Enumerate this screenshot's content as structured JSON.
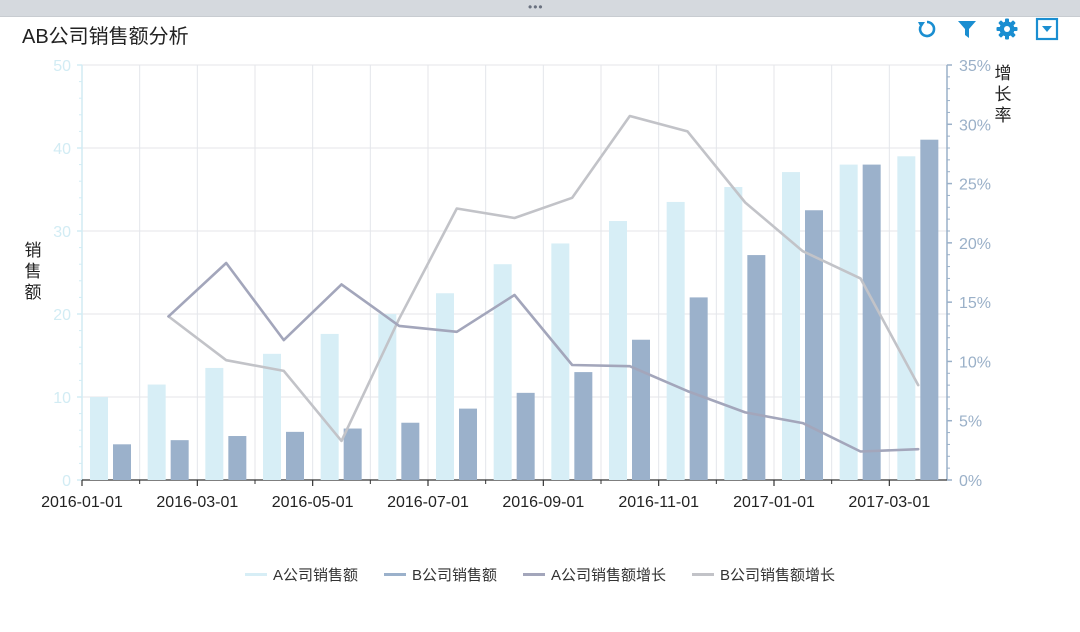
{
  "title": "AB公司销售额分析",
  "handle": "•••",
  "toolbar": [
    {
      "name": "refresh-icon",
      "icon": "refresh"
    },
    {
      "name": "filter-icon",
      "icon": "filter"
    },
    {
      "name": "gear-icon",
      "icon": "gear"
    },
    {
      "name": "dropdown-icon",
      "icon": "dropdown"
    }
  ],
  "colors": {
    "a_sales": "#d7eef6",
    "b_sales": "#9bb1cb",
    "a_growth": "#a3a6bb",
    "b_growth": "#c2c3c8",
    "toolbar": "#1a8ed1",
    "left_axis": "#d2ecf4",
    "right_axis": "#9ab0c8"
  },
  "chart_data": {
    "type": "bar",
    "title": "AB公司销售额分析",
    "x_ticks": [
      "2016-01-01",
      "2016-03-01",
      "2016-05-01",
      "2016-07-01",
      "2016-09-01",
      "2016-11-01",
      "2017-01-01",
      "2017-03-01"
    ],
    "y_left": {
      "label": "销售额",
      "min": 0,
      "max": 50,
      "ticks": [
        0,
        10,
        20,
        30,
        40,
        50
      ]
    },
    "y_right": {
      "label": "增长率",
      "min": 0,
      "max": 35,
      "ticks": [
        "0%",
        "5%",
        "10%",
        "15%",
        "20%",
        "25%",
        "30%",
        "35%"
      ]
    },
    "grid": true,
    "legend_position": "bottom",
    "series": [
      {
        "name": "A公司销售额",
        "type": "bar",
        "axis": "left",
        "values": [
          10.0,
          11.5,
          13.5,
          15.2,
          17.6,
          20.0,
          22.5,
          26.0,
          28.5,
          31.2,
          33.5,
          35.3,
          37.1,
          38.0,
          39.0
        ]
      },
      {
        "name": "B公司销售额",
        "type": "bar",
        "axis": "left",
        "values": [
          4.3,
          4.8,
          5.3,
          5.8,
          6.2,
          6.9,
          8.6,
          10.5,
          13.0,
          16.9,
          22.0,
          27.1,
          32.5,
          38.0,
          41.0
        ]
      },
      {
        "name": "A公司销售额增长",
        "type": "line",
        "axis": "right",
        "values": [
          null,
          13.8,
          18.3,
          11.8,
          16.5,
          13.0,
          12.5,
          15.6,
          9.7,
          9.6,
          7.5,
          5.7,
          4.8,
          2.4,
          2.6
        ]
      },
      {
        "name": "B公司销售额增长",
        "type": "line",
        "axis": "right",
        "values": [
          null,
          13.8,
          10.1,
          9.2,
          3.3,
          13.6,
          22.9,
          22.1,
          23.8,
          30.7,
          29.4,
          23.4,
          19.3,
          17.0,
          8.0
        ]
      }
    ]
  }
}
